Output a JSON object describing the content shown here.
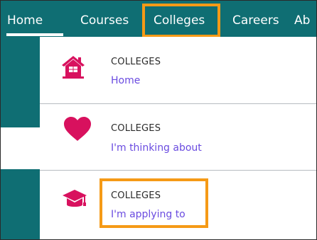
{
  "nav": {
    "items": [
      {
        "label": "Home"
      },
      {
        "label": "Courses"
      },
      {
        "label": "Colleges"
      },
      {
        "label": "Careers"
      },
      {
        "label": "Ab"
      }
    ]
  },
  "dropdown": {
    "items": [
      {
        "title": "COLLEGES",
        "subtitle": "Home",
        "icon": "house-icon"
      },
      {
        "title": "COLLEGES",
        "subtitle": "I'm thinking about",
        "icon": "heart-icon"
      },
      {
        "title": "COLLEGES",
        "subtitle": "I'm applying to",
        "icon": "graduation-cap-icon"
      }
    ]
  },
  "colors": {
    "nav_bg": "#0f6e73",
    "accent_pink": "#d8115e",
    "highlight_orange": "#f59a16",
    "link_purple": "#6a4be0"
  }
}
